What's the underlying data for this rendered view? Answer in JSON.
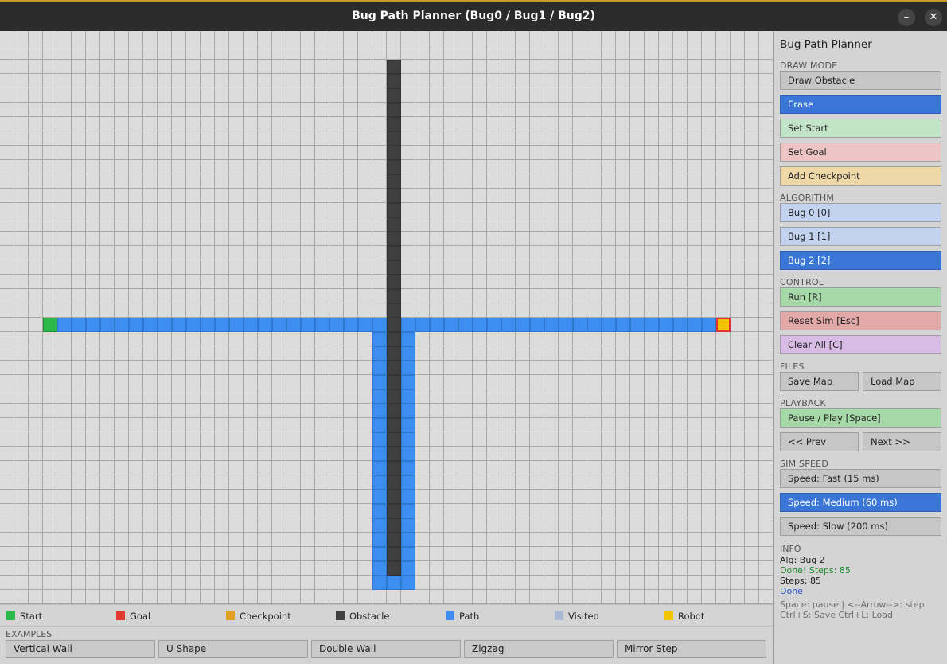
{
  "window": {
    "title": "Bug Path Planner  (Bug0 / Bug1 / Bug2)",
    "minimize_glyph": "–",
    "close_glyph": "✕"
  },
  "legend": [
    {
      "label": "Start",
      "color": "#2db84a"
    },
    {
      "label": "Goal",
      "color": "#e03a2f"
    },
    {
      "label": "Checkpoint",
      "color": "#e0a020"
    },
    {
      "label": "Obstacle",
      "color": "#3f3f3f"
    },
    {
      "label": "Path",
      "color": "#3d8ef0"
    },
    {
      "label": "Visited",
      "color": "#a9b9d4"
    },
    {
      "label": "Robot",
      "color": "#f2c400"
    }
  ],
  "examples": {
    "header": "EXAMPLES",
    "buttons": [
      "Vertical Wall",
      "U Shape",
      "Double Wall",
      "Zigzag",
      "Mirror Step"
    ]
  },
  "panel": {
    "title": "Bug Path Planner",
    "draw_mode": {
      "header": "DRAW MODE",
      "draw_obstacle": "Draw Obstacle",
      "erase": "Erase",
      "set_start": "Set Start",
      "set_goal": "Set Goal",
      "add_checkpoint": "Add Checkpoint"
    },
    "algorithm": {
      "header": "ALGORITHM",
      "bug0": "Bug 0 [0]",
      "bug1": "Bug 1 [1]",
      "bug2": "Bug 2 [2]"
    },
    "control": {
      "header": "CONTROL",
      "run": "Run  [R]",
      "reset": "Reset Sim  [Esc]",
      "clear": "Clear All  [C]"
    },
    "files": {
      "header": "FILES",
      "save": "Save Map",
      "load": "Load Map"
    },
    "playback": {
      "header": "PLAYBACK",
      "pause_play": "Pause / Play  [Space]",
      "prev": "<< Prev",
      "next": "Next >>"
    },
    "sim_speed": {
      "header": "SIM SPEED",
      "fast": "Speed: Fast   (15 ms)",
      "medium": "Speed: Medium (60 ms)",
      "slow": "Speed: Slow  (200 ms)"
    },
    "info": {
      "header": "INFO",
      "alg": "Alg: Bug 2",
      "done_steps": "Done!  Steps: 85",
      "steps": "Steps: 85",
      "status": "Done",
      "hint1": "Space: pause | <--Arrow-->: step",
      "hint2": "Ctrl+S: Save    Ctrl+L: Load",
      "colors": {
        "done_steps": "#1a8a2a",
        "status": "#2a55c8",
        "hint": "#707070"
      }
    },
    "active": {
      "draw_mode": "erase",
      "algorithm": "bug2",
      "speed": "medium"
    }
  },
  "grid": {
    "cols": 54,
    "rows": 40,
    "start": {
      "col": 3,
      "row": 20
    },
    "robot": {
      "col": 50,
      "row": 20
    },
    "obstacle_cells": {
      "col": 27,
      "row_from": 2,
      "row_to": 37
    },
    "path_horizontal": {
      "row": 20,
      "col_from": 4,
      "col_to": 49
    },
    "path_vertical_columns": [
      26,
      28
    ],
    "path_vertical_rows": {
      "row_from": 21,
      "row_to": 38
    },
    "path_bottom_row": 38
  }
}
